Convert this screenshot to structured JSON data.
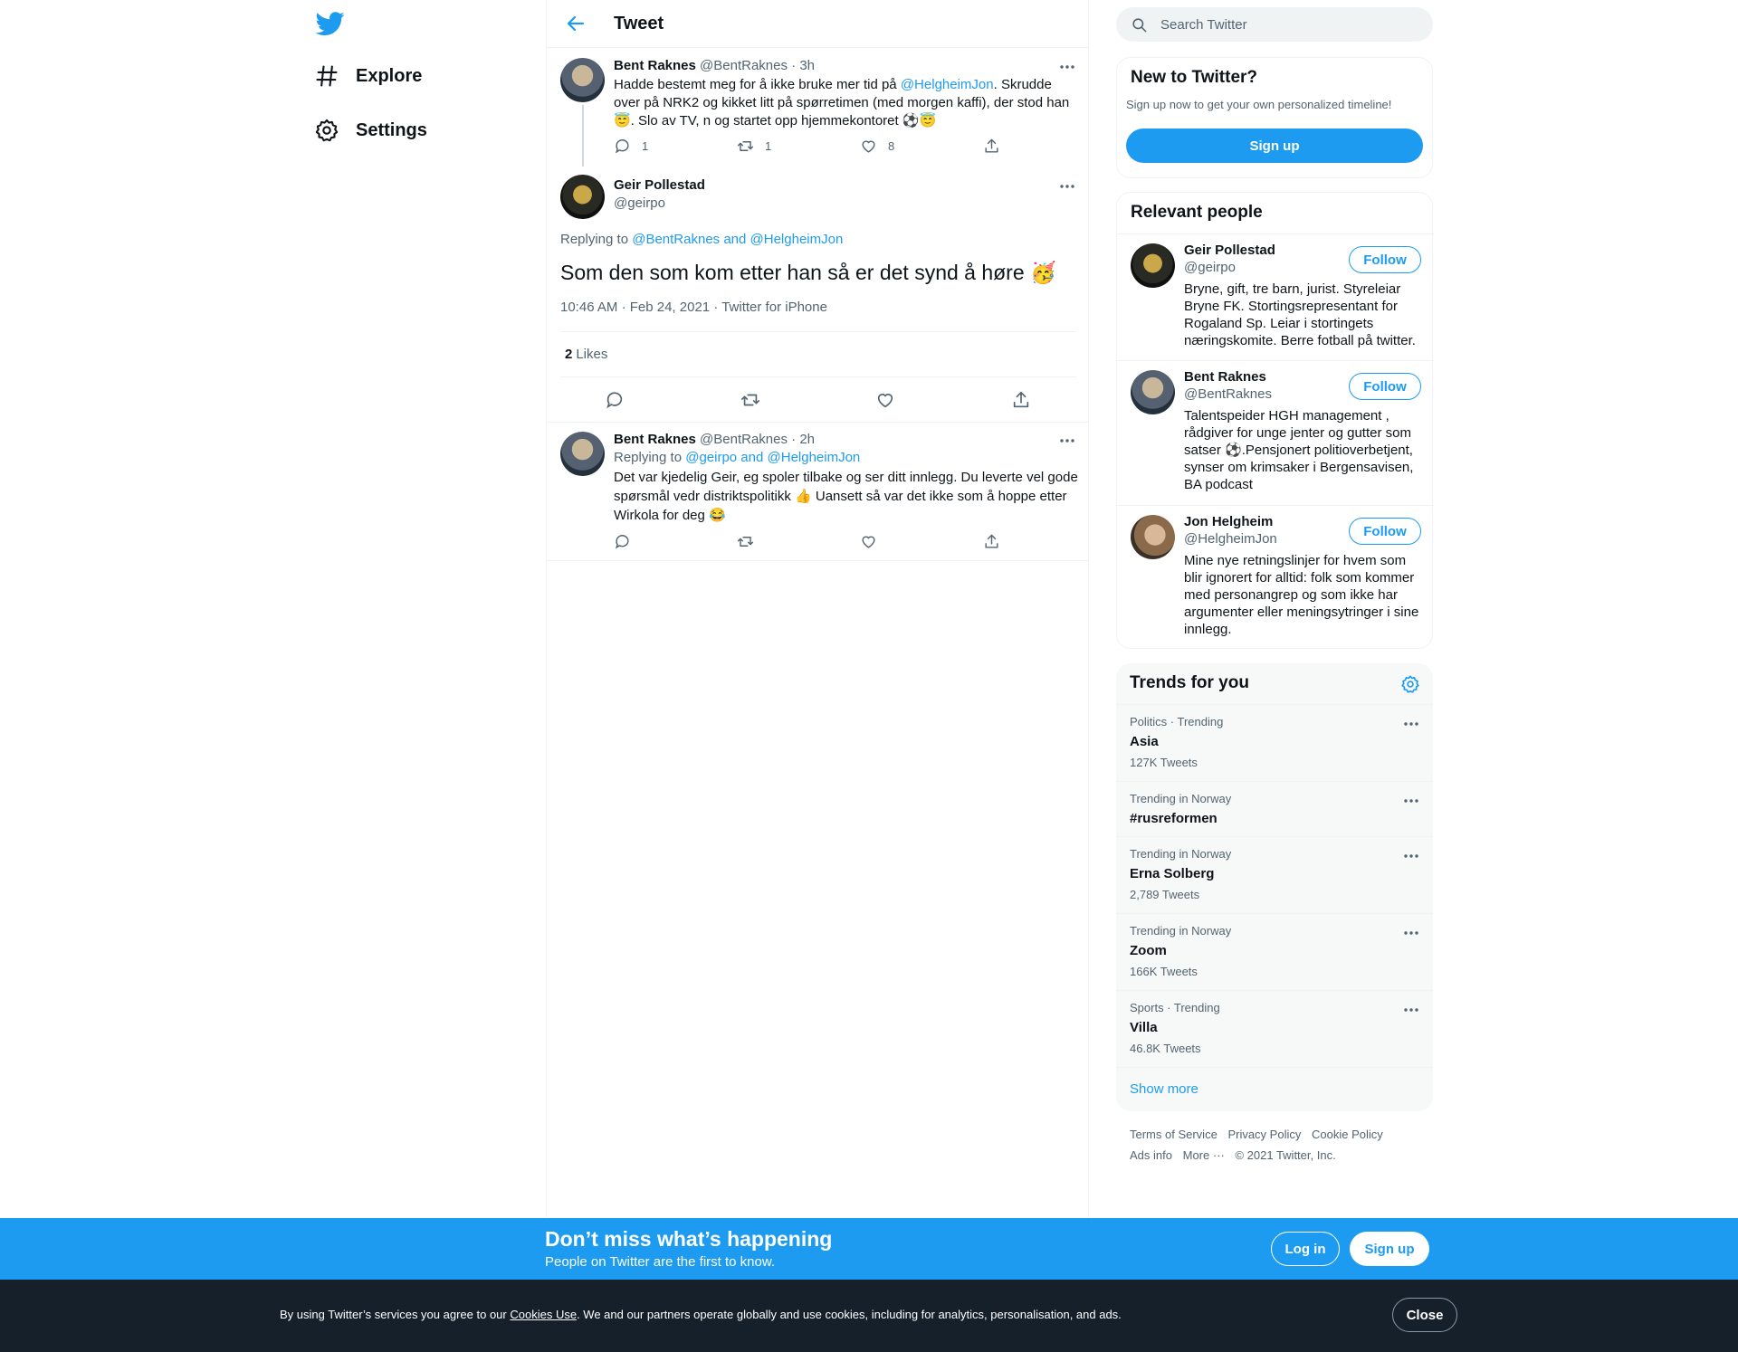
{
  "nav": {
    "explore": "Explore",
    "settings": "Settings"
  },
  "header": {
    "title": "Tweet"
  },
  "parent_tweet": {
    "name": "Bent Raknes",
    "handle": "@BentRaknes",
    "sep": "·",
    "time": "3h",
    "text_1": "Hadde bestemt meg for å ikke bruke mer tid på ",
    "mention": "@HelgheimJon",
    "text_2": ". Skrudde over på NRK2 og kikket litt på spørretimen (med morgen kaffi), der stod han 😇. Slo av TV, n og startet opp hjemmekontoret ⚽😇",
    "replies": "1",
    "retweets": "1",
    "likes": "8"
  },
  "main_tweet": {
    "name": "Geir Pollestad",
    "handle": "@geirpo",
    "replying_to_label": "Replying to ",
    "replying_to_users": "@BentRaknes and @HelgheimJon",
    "text": "Som den som kom etter han så er det synd å høre 🥳",
    "time": "10:46 AM",
    "sep": "·",
    "date": "Feb 24, 2021",
    "source": "Twitter for iPhone",
    "likes_count": "2",
    "likes_label": "Likes"
  },
  "reply_tweet": {
    "name": "Bent Raknes",
    "handle": "@BentRaknes",
    "sep": "·",
    "time": "2h",
    "replying_to_label": "Replying to ",
    "replying_to_users": "@geirpo and @HelgheimJon",
    "text": "Det var kjedelig Geir, eg spoler tilbake og ser ditt innlegg. Du leverte vel gode spørsmål vedr distriktspolitikk 👍 Uansett så var det ikke som å hoppe etter Wirkola for deg 😂"
  },
  "search": {
    "placeholder": "Search Twitter"
  },
  "new_to_twitter": {
    "title": "New to Twitter?",
    "subtitle": "Sign up now to get your own personalized timeline!",
    "signup": "Sign up"
  },
  "relevant_people": {
    "title": "Relevant people",
    "follow_label": "Follow",
    "people": [
      {
        "name": "Geir Pollestad",
        "handle": "@geirpo",
        "bio": "Bryne, gift, tre barn, jurist. Styreleiar Bryne FK. Stortingsrepresentant for Rogaland Sp. Leiar i stortingets næringskomite. Berre fotball på twitter."
      },
      {
        "name": "Bent Raknes",
        "handle": "@BentRaknes",
        "bio": "Talentspeider HGH management , rådgiver for unge jenter og gutter som satser ⚽.Pensjonert politioverbetjent, synser om krimsaker i Bergensavisen, BA podcast"
      },
      {
        "name": "Jon Helgheim",
        "handle": "@HelgheimJon",
        "bio": "Mine nye retningslinjer for hvem som blir ignorert for alltid: folk som kommer med personangrep og som ikke har argumenter eller meningsytringer i sine innlegg."
      }
    ]
  },
  "trends": {
    "title": "Trends for you",
    "items": [
      {
        "meta": "Politics · Trending",
        "name": "Asia",
        "count": "127K Tweets"
      },
      {
        "meta": "Trending in Norway",
        "name": "#rusreformen",
        "count": ""
      },
      {
        "meta": "Trending in Norway",
        "name": "Erna Solberg",
        "count": "2,789 Tweets"
      },
      {
        "meta": "Trending in Norway",
        "name": "Zoom",
        "count": "166K Tweets"
      },
      {
        "meta": "Sports · Trending",
        "name": "Villa",
        "count": "46.8K Tweets"
      }
    ],
    "show_more": "Show more"
  },
  "footer": {
    "terms": "Terms of Service",
    "privacy": "Privacy Policy",
    "cookie": "Cookie Policy",
    "ads": "Ads info",
    "more": "More ···",
    "copyright": "© 2021 Twitter, Inc."
  },
  "signup_bar": {
    "headline": "Don’t miss what’s happening",
    "sub": "People on Twitter are the first to know.",
    "login": "Log in",
    "signup": "Sign up"
  },
  "cookie_bar": {
    "text_1": "By using Twitter’s services you agree to our ",
    "link": "Cookies Use",
    "text_2": ". We and our partners operate globally and use cookies, including for analytics, personalisation, and ads.",
    "close": "Close"
  },
  "colors": {
    "accent": "#1d9bf0",
    "cookie_bar_bg": "#15202b",
    "secondary_text": "#536471"
  }
}
